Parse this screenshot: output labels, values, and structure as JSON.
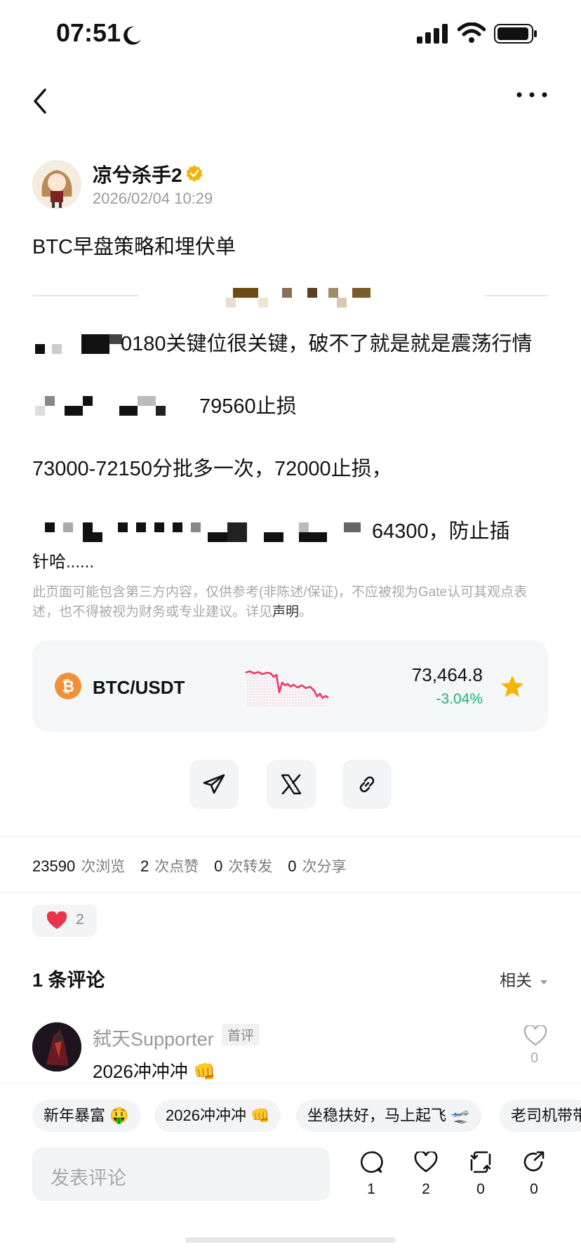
{
  "status_bar": {
    "time": "07:51"
  },
  "post": {
    "author": "凉兮杀手2",
    "date": "2026/02/04 10:29",
    "title": "BTC早盘策略和埋伏单",
    "lines": [
      "0180关键位很关键，破不了就是就是震荡行情",
      "79560止损",
      "73000-72150分批多一次，72000止损，",
      "64300，防止插",
      "针哈......"
    ],
    "disclaimer_text": "此页面可能包含第三方内容，仅供参考(非陈述/保证)，不应被视为Gate认可其观点表述，也不得被视为财务或专业建议。详见",
    "disclaimer_link": "声明",
    "disclaimer_end": "。"
  },
  "ticker": {
    "pair": "BTC/USDT",
    "price": "73,464.8",
    "change": "-3.04%",
    "coin_icon": "bitcoin-icon",
    "change_color": "#1bb37a",
    "accent_star": "#f7b500"
  },
  "stats": {
    "views": "23590",
    "views_label": "次浏览",
    "likes": "2",
    "likes_label": "次点赞",
    "reposts": "0",
    "reposts_label": "次转发",
    "shares": "0",
    "shares_label": "次分享"
  },
  "reaction": {
    "icon": "heart-icon",
    "count": "2"
  },
  "comments": {
    "title": "1 条评论",
    "sort": "相关",
    "items": [
      {
        "user": "弑天Supporter",
        "badge": "首评",
        "text": "2026冲冲冲 👊",
        "likes": "0"
      }
    ]
  },
  "quick_replies": [
    "新年暴富 🤑",
    "2026冲冲冲 👊",
    "坐稳扶好，马上起飞 🛫",
    "老司机带带"
  ],
  "composer": {
    "placeholder": "发表评论"
  },
  "actions": {
    "comment": "1",
    "like": "2",
    "repost": "0",
    "share": "0"
  }
}
